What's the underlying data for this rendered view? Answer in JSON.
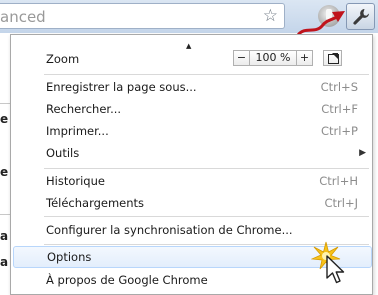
{
  "toolbar": {
    "omnibox_text": "anced",
    "star_icon": "star-icon",
    "wrench_icon": "wrench-icon"
  },
  "background_text": [
    "e",
    "e",
    "a",
    "a"
  ],
  "menu": {
    "zoom": {
      "label": "Zoom",
      "out": "−",
      "value": "100 %",
      "in": "+"
    },
    "items": [
      {
        "label": "Enregistrer la page sous...",
        "shortcut": "Ctrl+S"
      },
      {
        "label": "Rechercher...",
        "shortcut": "Ctrl+F"
      },
      {
        "label": "Imprimer...",
        "shortcut": "Ctrl+P"
      },
      {
        "label": "Outils",
        "shortcut": ""
      },
      {
        "label": "Historique",
        "shortcut": "Ctrl+H"
      },
      {
        "label": "Téléchargements",
        "shortcut": "Ctrl+J"
      },
      {
        "label": "Configurer la synchronisation de Chrome...",
        "shortcut": ""
      },
      {
        "label": "Options",
        "shortcut": ""
      },
      {
        "label": "À propos de Google Chrome",
        "shortcut": ""
      }
    ],
    "highlighted_item": "Options"
  },
  "colors": {
    "highlight_border": "#b8d6fb",
    "arrow_red": "#c0141c",
    "shortcut_gray": "#8c8c8c"
  }
}
